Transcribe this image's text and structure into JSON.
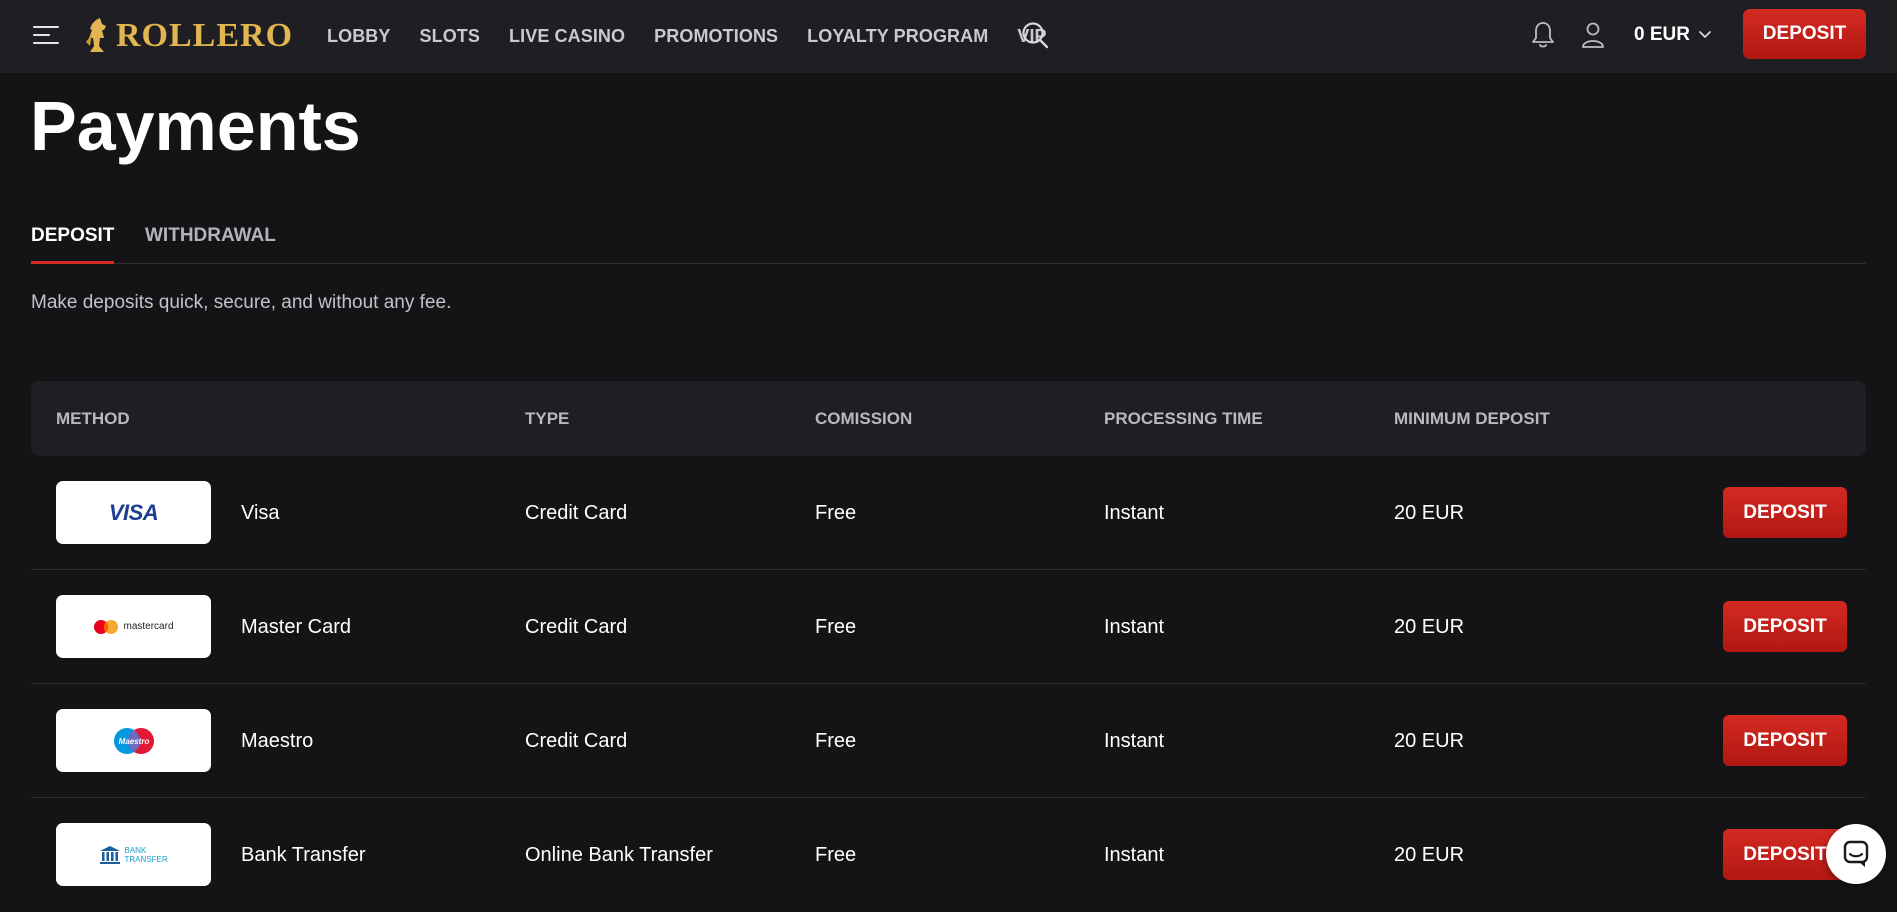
{
  "header": {
    "logo_text": "ROLLERO",
    "nav": [
      "LOBBY",
      "SLOTS",
      "LIVE CASINO",
      "PROMOTIONS",
      "LOYALTY PROGRAM",
      "VIP"
    ],
    "balance": "0 EUR",
    "deposit_label": "DEPOSIT",
    "icons": [
      "menu-icon",
      "search-icon",
      "bell-icon",
      "user-icon",
      "chevron-down-icon"
    ]
  },
  "page": {
    "title": "Payments",
    "tabs": [
      {
        "label": "DEPOSIT",
        "active": true
      },
      {
        "label": "WITHDRAWAL",
        "active": false
      }
    ],
    "subtitle": "Make deposits quick, secure, and without any fee."
  },
  "table": {
    "headers": {
      "method": "METHOD",
      "type": "TYPE",
      "comission": "COMISSION",
      "time": "PROCESSING TIME",
      "min": "MINIMUM DEPOSIT"
    },
    "rows": [
      {
        "name": "Visa",
        "logo": "VISA",
        "type": "Credit Card",
        "comission": "Free",
        "time": "Instant",
        "min": "20 EUR",
        "action": "DEPOSIT"
      },
      {
        "name": "Master Card",
        "logo": "mastercard",
        "type": "Credit Card",
        "comission": "Free",
        "time": "Instant",
        "min": "20 EUR",
        "action": "DEPOSIT"
      },
      {
        "name": "Maestro",
        "logo": "Maestro",
        "type": "Credit Card",
        "comission": "Free",
        "time": "Instant",
        "min": "20 EUR",
        "action": "DEPOSIT"
      },
      {
        "name": "Bank Transfer",
        "logo": "BANK TRANSFER",
        "type": "Online Bank Transfer",
        "comission": "Free",
        "time": "Instant",
        "min": "20 EUR",
        "action": "DEPOSIT"
      }
    ]
  },
  "colors": {
    "background": "#141417",
    "header": "#1f1f23",
    "accent_red": "#d32a22",
    "logo_gold": "#e1b54f"
  }
}
